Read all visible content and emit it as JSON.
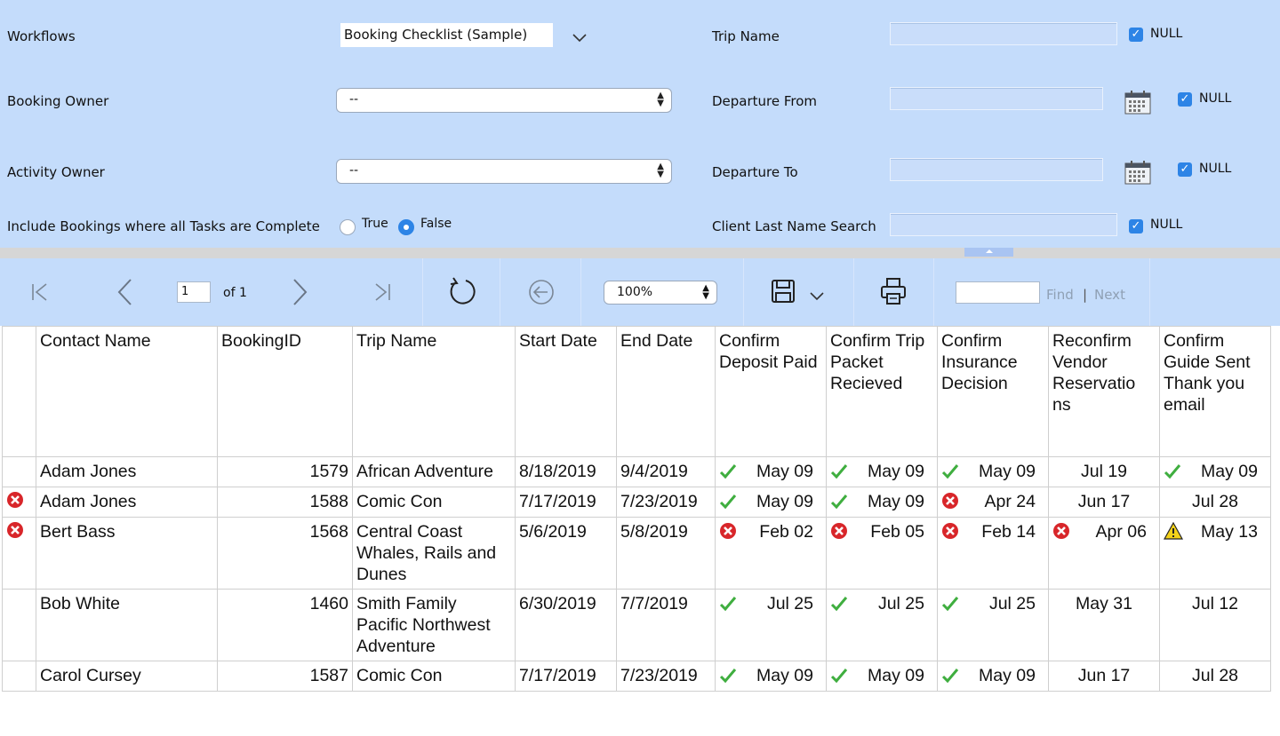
{
  "params": {
    "workflows": {
      "label": "Workflows",
      "value": "Booking Checklist (Sample)"
    },
    "booking_owner": {
      "label": "Booking Owner",
      "value": "--"
    },
    "activity_owner": {
      "label": "Activity Owner",
      "value": "--"
    },
    "include_complete": {
      "label": "Include Bookings where all Tasks are Complete",
      "true_label": "True",
      "false_label": "False",
      "selected": "False"
    },
    "trip_name": {
      "label": "Trip Name",
      "value": "",
      "null_label": "NULL",
      "null_checked": true
    },
    "departure_from": {
      "label": "Departure From",
      "value": "",
      "null_label": "NULL",
      "null_checked": true
    },
    "departure_to": {
      "label": "Departure To",
      "value": "",
      "null_label": "NULL",
      "null_checked": true
    },
    "client_last_name": {
      "label": "Client Last Name Search",
      "value": "",
      "null_label": "NULL",
      "null_checked": true
    }
  },
  "toolbar": {
    "page": "1",
    "of_label": "of 1",
    "zoom": "100%",
    "find_value": "",
    "find_label": "Find",
    "separator": "|",
    "next_label": "Next"
  },
  "table": {
    "columns": [
      "",
      "Contact Name",
      "BookingID",
      "Trip Name",
      "Start Date",
      "End Date",
      "Confirm Deposit Paid",
      "Confirm Trip Packet Recieved",
      "Confirm Insurance Decision",
      "Reconfirm Vendor Reservatio ns",
      "Confirm Guide Sent Thank you email"
    ],
    "rows": [
      {
        "flag": "",
        "contact": "Adam Jones",
        "id": "1579",
        "trip": "African Adventure",
        "start": "8/18/2019",
        "end": "9/4/2019",
        "c1": {
          "icon": "check",
          "text": "May 09"
        },
        "c2": {
          "icon": "check",
          "text": "May 09"
        },
        "c3": {
          "icon": "check",
          "text": "May 09"
        },
        "c4": {
          "icon": "",
          "text": "Jul 19"
        },
        "c5": {
          "icon": "check",
          "text": "May 09"
        }
      },
      {
        "flag": "error",
        "contact": "Adam Jones",
        "id": "1588",
        "trip": "Comic Con",
        "start": "7/17/2019",
        "end": "7/23/2019",
        "c1": {
          "icon": "check",
          "text": "May 09"
        },
        "c2": {
          "icon": "check",
          "text": "May 09"
        },
        "c3": {
          "icon": "error",
          "text": "Apr 24"
        },
        "c4": {
          "icon": "",
          "text": "Jun 17"
        },
        "c5": {
          "icon": "",
          "text": "Jul 28"
        }
      },
      {
        "flag": "error",
        "contact": "Bert Bass",
        "id": "1568",
        "trip": "Central Coast Whales, Rails and Dunes",
        "start": "5/6/2019",
        "end": "5/8/2019",
        "c1": {
          "icon": "error",
          "text": "Feb 02"
        },
        "c2": {
          "icon": "error",
          "text": "Feb 05"
        },
        "c3": {
          "icon": "error",
          "text": "Feb 14"
        },
        "c4": {
          "icon": "error",
          "text": "Apr 06"
        },
        "c5": {
          "icon": "warning",
          "text": "May 13"
        }
      },
      {
        "flag": "",
        "contact": "Bob White",
        "id": "1460",
        "trip": "Smith Family Pacific Northwest Adventure",
        "start": "6/30/2019",
        "end": "7/7/2019",
        "c1": {
          "icon": "check",
          "text": "Jul 25"
        },
        "c2": {
          "icon": "check",
          "text": "Jul 25"
        },
        "c3": {
          "icon": "check",
          "text": "Jul 25"
        },
        "c4": {
          "icon": "",
          "text": "May 31"
        },
        "c5": {
          "icon": "",
          "text": "Jul 12"
        }
      },
      {
        "flag": "",
        "contact": "Carol Cursey",
        "id": "1587",
        "trip": "Comic Con",
        "start": "7/17/2019",
        "end": "7/23/2019",
        "c1": {
          "icon": "check",
          "text": "May 09"
        },
        "c2": {
          "icon": "check",
          "text": "May 09"
        },
        "c3": {
          "icon": "check",
          "text": "May 09"
        },
        "c4": {
          "icon": "",
          "text": "Jun 17"
        },
        "c5": {
          "icon": "",
          "text": "Jul 28"
        }
      }
    ]
  },
  "colors": {
    "panel": "#c4dcfb",
    "accent": "#2d84e6",
    "check": "#3fae3f",
    "error": "#d8262a",
    "warning": "#f4d21a"
  }
}
